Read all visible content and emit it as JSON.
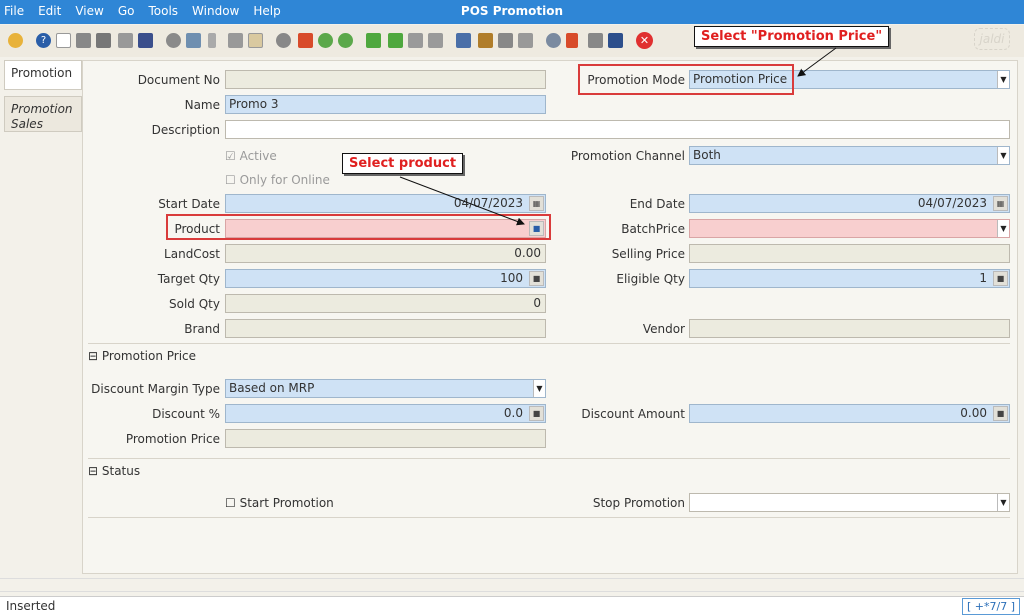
{
  "window": {
    "title": "POS Promotion"
  },
  "menu": [
    "File",
    "Edit",
    "View",
    "Go",
    "Tools",
    "Window",
    "Help"
  ],
  "toolbar_icons": [
    "undo-icon",
    "help-icon",
    "new-icon",
    "copy-icon",
    "delete-icon",
    "refresh-icon",
    "save-icon",
    "requery-icon",
    "zoom-icon",
    "attach-icon",
    "chat-icon",
    "history-icon",
    "lock-icon",
    "home-icon",
    "back-icon",
    "forward-icon",
    "first-icon",
    "prev-icon",
    "next-icon",
    "last-icon",
    "report-icon",
    "archive-icon",
    "print-icon",
    "print-preview-icon",
    "zoom-across-icon",
    "workflow-icon",
    "product-info-icon",
    "calendar-icon",
    "close-icon"
  ],
  "tabs": [
    "Promotion",
    "Promotion Sales"
  ],
  "form": {
    "document_no": {
      "label": "Document No",
      "value": ""
    },
    "name": {
      "label": "Name",
      "value": "Promo 3"
    },
    "description": {
      "label": "Description",
      "value": ""
    },
    "active": {
      "label": "Active",
      "checked": true
    },
    "only_online": {
      "label": "Only for Online",
      "checked": false
    },
    "promotion_mode": {
      "label": "Promotion Mode",
      "value": "Promotion Price"
    },
    "promotion_channel": {
      "label": "Promotion Channel",
      "value": "Both"
    },
    "start_date": {
      "label": "Start Date",
      "value": "04/07/2023"
    },
    "end_date": {
      "label": "End Date",
      "value": "04/07/2023"
    },
    "product": {
      "label": "Product",
      "value": ""
    },
    "batch_price": {
      "label": "BatchPrice",
      "value": ""
    },
    "land_cost": {
      "label": "LandCost",
      "value": "0.00"
    },
    "selling_price": {
      "label": "Selling Price",
      "value": ""
    },
    "target_qty": {
      "label": "Target Qty",
      "value": "100"
    },
    "eligible_qty": {
      "label": "Eligible Qty",
      "value": "1"
    },
    "sold_qty": {
      "label": "Sold Qty",
      "value": "0"
    },
    "brand": {
      "label": "Brand",
      "value": ""
    },
    "vendor": {
      "label": "Vendor",
      "value": ""
    }
  },
  "promotion_price_section": {
    "title": "Promotion Price",
    "discount_margin_type": {
      "label": "Discount Margin Type",
      "value": "Based on MRP"
    },
    "discount_pct": {
      "label": "Discount %",
      "value": "0.0"
    },
    "discount_amount": {
      "label": "Discount Amount",
      "value": "0.00"
    },
    "promotion_price": {
      "label": "Promotion Price",
      "value": ""
    }
  },
  "status_section": {
    "title": "Status",
    "start_promotion": {
      "label": "Start Promotion",
      "checked": false
    },
    "stop_promotion": {
      "label": "Stop Promotion",
      "value": ""
    }
  },
  "callouts": {
    "promotion_price": "Select \"Promotion Price\"",
    "product": "Select product"
  },
  "statusbar": {
    "text": "Inserted",
    "record": "[ +*7/7 ]"
  },
  "logo_text": "jaldi",
  "colors": {
    "titlebar": "#2f86d6",
    "mandatory": "#f8cfcf",
    "editable": "#cfe2f5",
    "annotation": "#e02020"
  }
}
